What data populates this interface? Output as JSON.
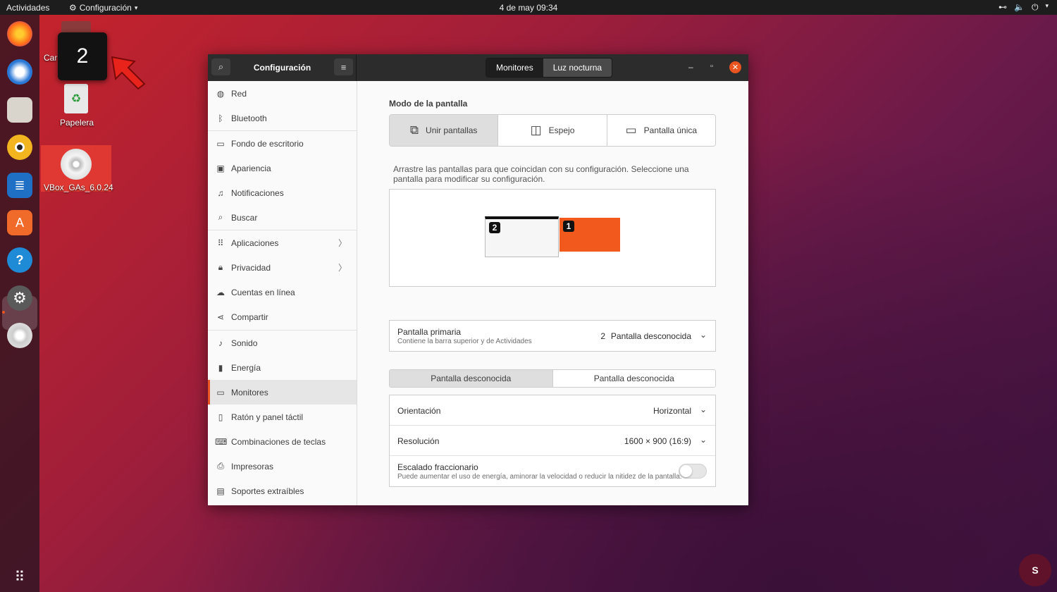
{
  "topbar": {
    "activities": "Actividades",
    "app_menu": "Configuración",
    "clock": "4 de may  09:34"
  },
  "desktop": {
    "workspace_popup": "2",
    "folder_label": "Car",
    "trash_label": "Papelera",
    "disc_label": "VBox_GAs_6.0.24"
  },
  "window": {
    "title": "Configuración",
    "tabs": [
      "Monitores",
      "Luz nocturna"
    ]
  },
  "sidebar": {
    "items": [
      {
        "label": "Red",
        "icon": "network-icon"
      },
      {
        "label": "Bluetooth",
        "icon": "bluetooth-icon"
      },
      {
        "label": "Fondo de escritorio",
        "icon": "wallpaper-icon"
      },
      {
        "label": "Apariencia",
        "icon": "appearance-icon"
      },
      {
        "label": "Notificaciones",
        "icon": "bell-icon"
      },
      {
        "label": "Buscar",
        "icon": "search-icon"
      },
      {
        "label": "Aplicaciones",
        "icon": "apps-grid-icon"
      },
      {
        "label": "Privacidad",
        "icon": "lock-icon"
      },
      {
        "label": "Cuentas en línea",
        "icon": "cloud-icon"
      },
      {
        "label": "Compartir",
        "icon": "share-icon"
      },
      {
        "label": "Sonido",
        "icon": "music-note-icon"
      },
      {
        "label": "Energía",
        "icon": "power-icon"
      },
      {
        "label": "Monitores",
        "icon": "monitor-icon"
      },
      {
        "label": "Ratón y panel táctil",
        "icon": "mouse-icon"
      },
      {
        "label": "Combinaciones de teclas",
        "icon": "keyboard-icon"
      },
      {
        "label": "Impresoras",
        "icon": "printer-icon"
      },
      {
        "label": "Soportes extraíbles",
        "icon": "media-icon"
      }
    ],
    "active": "Monitores"
  },
  "content": {
    "mode_title": "Modo de la pantalla",
    "modes": [
      "Unir pantallas",
      "Espejo",
      "Pantalla única"
    ],
    "selected_mode": "Unir pantallas",
    "hint": "Arrastre las pantallas para que coincidan con su configuración. Seleccione una pantalla para modificar su configuración.",
    "monitor_badges": [
      "2",
      "1"
    ],
    "primary": {
      "title": "Pantalla primaria",
      "subtitle": "Contiene la barra superior y de Actividades",
      "number": "2",
      "value": "Pantalla desconocida"
    },
    "display_tabs": [
      "Pantalla desconocida",
      "Pantalla desconocida"
    ],
    "orientation": {
      "label": "Orientación",
      "value": "Horizontal"
    },
    "resolution": {
      "label": "Resolución",
      "value": "1600 × 900 (16:9)"
    },
    "scaling": {
      "label": "Escalado fraccionario",
      "subtitle": "Puede aumentar el uso de energía, aminorar la velocidad o reducir la nitidez de la pantalla.",
      "enabled": false
    }
  },
  "colors": {
    "accent": "#e95420",
    "secondary_monitor": "#f25a1d"
  }
}
